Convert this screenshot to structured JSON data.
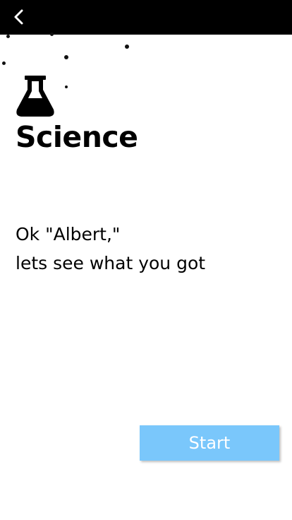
{
  "header": {
    "back_icon": "chevron-left-icon"
  },
  "category": {
    "icon": "flask-icon",
    "title": "Science"
  },
  "message": {
    "line1": "Ok \"Albert,\"",
    "line2": "lets see what you got"
  },
  "actions": {
    "start_label": "Start"
  },
  "colors": {
    "topbar": "#000000",
    "start_button": "#7ac7fb",
    "start_text": "#ffffff"
  }
}
